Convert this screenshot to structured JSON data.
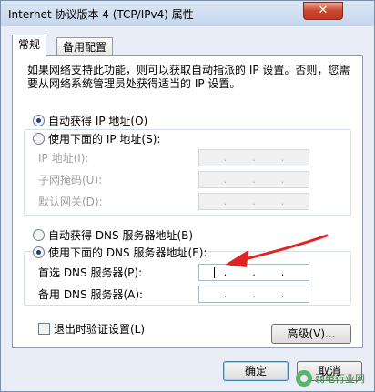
{
  "window": {
    "title": "Internet 协议版本 4 (TCP/IPv4) 属性",
    "close_label": "✕"
  },
  "tabs": [
    {
      "label": "常规"
    },
    {
      "label": "备用配置"
    }
  ],
  "description": "如果网络支持此功能，则可以获取自动指派的 IP 设置。否则，您需要从网络系统管理员处获得适当的 IP 设置。",
  "ip": {
    "auto_label": "自动获得 IP 地址(O)",
    "manual_label": "使用下面的 IP 地址(S):",
    "selected": "auto",
    "fields": [
      {
        "label": "IP 地址(I):",
        "octets": [
          "",
          "",
          "",
          ""
        ]
      },
      {
        "label": "子网掩码(U):",
        "octets": [
          "",
          "",
          "",
          ""
        ]
      },
      {
        "label": "默认网关(D):",
        "octets": [
          "",
          "",
          "",
          ""
        ]
      }
    ]
  },
  "dns": {
    "auto_label": "自动获得 DNS 服务器地址(B)",
    "manual_label": "使用下面的 DNS 服务器地址(E):",
    "selected": "manual",
    "fields": [
      {
        "label": "首选 DNS 服务器(P):",
        "octets": [
          "",
          "",
          "",
          ""
        ]
      },
      {
        "label": "备用 DNS 服务器(A):",
        "octets": [
          "",
          "",
          "",
          ""
        ]
      }
    ]
  },
  "validate_label": "退出时验证设置(L)",
  "advanced_label": "高级(V)...",
  "ok_label": "确定",
  "cancel_label": "取消",
  "watermark": "弱电行业网",
  "colors": {
    "arrow": "#e02424",
    "selected_radio": "#1a3f8f"
  }
}
